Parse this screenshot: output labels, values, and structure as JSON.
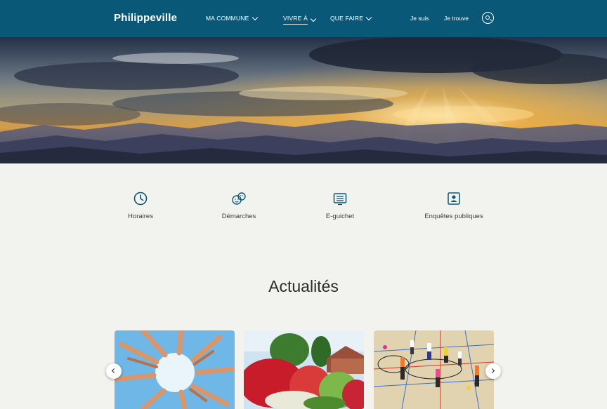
{
  "header": {
    "logo": "Philippeville",
    "nav": [
      {
        "label": "MA COMMUNE"
      },
      {
        "label": "VIVRE À"
      },
      {
        "label": "QUE FAIRE"
      }
    ],
    "links": [
      {
        "label": "Je suis"
      },
      {
        "label": "Je trouve"
      }
    ],
    "accent_color": "#0a5877"
  },
  "quick_links": [
    {
      "label": "Horaires",
      "icon": "clock-icon"
    },
    {
      "label": "Démarches",
      "icon": "smileys-icon"
    },
    {
      "label": "E-guichet",
      "icon": "list-icon"
    },
    {
      "label": "Enquêtes publiques",
      "icon": "id-card-icon"
    }
  ],
  "news": {
    "title": "Actualités",
    "cards": [
      {
        "image": "hands-circle-photo"
      },
      {
        "image": "red-shrubs-garden-photo"
      },
      {
        "image": "children-gym-photo"
      }
    ]
  }
}
